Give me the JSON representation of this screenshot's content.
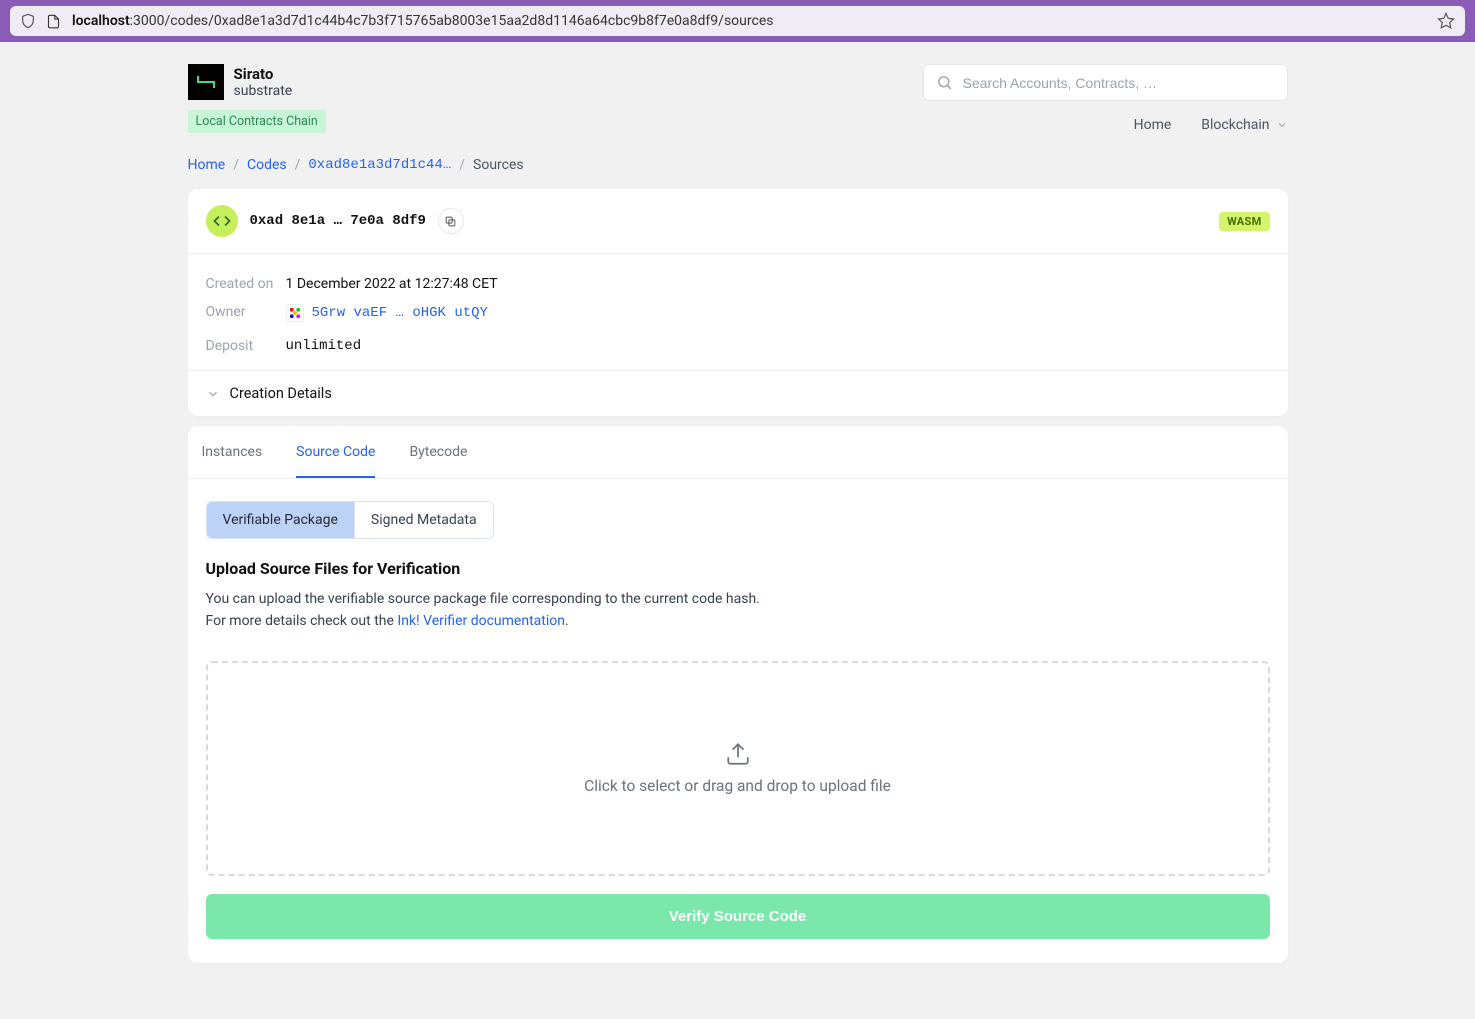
{
  "browser": {
    "url_host": "localhost",
    "url_rest": ":3000/codes/0xad8e1a3d7d1c44b4c7b3f715765ab8003e15aa2d8d1146a64cbc9b8f7e0a8df9/sources"
  },
  "brand": {
    "name": "Sirato",
    "sub": "substrate"
  },
  "chain_badge": "Local Contracts Chain",
  "search": {
    "placeholder": "Search Accounts, Contracts, …"
  },
  "nav": {
    "home": "Home",
    "blockchain": "Blockchain"
  },
  "breadcrumb": {
    "home": "Home",
    "codes": "Codes",
    "code_hash_short": "0xad8e1a3d7d1c44…",
    "current": "Sources"
  },
  "code": {
    "hash_display": "0xad 8e1a … 7e0a 8df9",
    "badge": "WASM"
  },
  "meta": {
    "created_on_label": "Created on",
    "created_on_value": "1 December 2022 at 12:27:48 CET",
    "owner_label": "Owner",
    "owner_value": "5Grw vaEF … oHGK utQY",
    "deposit_label": "Deposit",
    "deposit_value": "unlimited",
    "creation_details": "Creation Details"
  },
  "tabs": {
    "instances": "Instances",
    "source_code": "Source Code",
    "bytecode": "Bytecode"
  },
  "subtabs": {
    "verifiable": "Verifiable Package",
    "signed": "Signed Metadata"
  },
  "upload": {
    "title": "Upload Source Files for Verification",
    "desc1": "You can upload the verifiable source package file corresponding to the current code hash.",
    "desc2_prefix": "For more details check out the ",
    "doc_link": "Ink! Verifier documentation",
    "desc2_suffix": ".",
    "dropzone_text": "Click to select or drag and drop to upload file",
    "verify_button": "Verify Source Code"
  }
}
